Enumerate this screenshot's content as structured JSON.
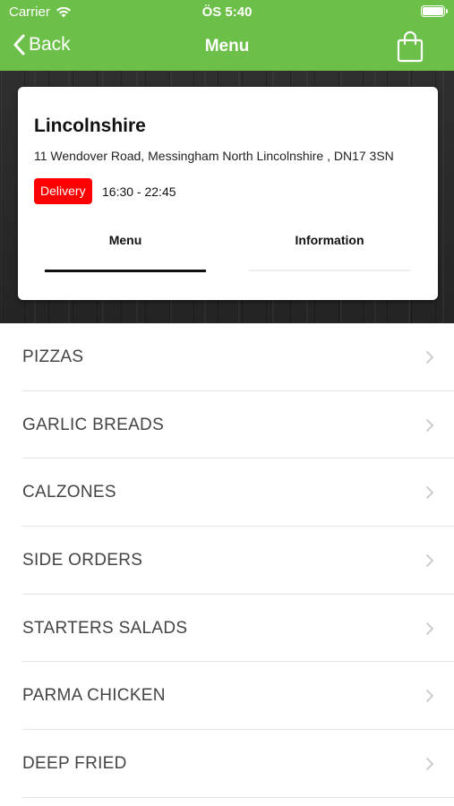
{
  "status_bar": {
    "carrier": "Carrier",
    "time": "ÖS 5:40"
  },
  "nav": {
    "back_label": "Back",
    "title": "Menu"
  },
  "restaurant": {
    "name": "Lincolnshire",
    "address": "11 Wendover Road, Messingham  North Lincolnshire , DN17 3SN",
    "badge": "Delivery",
    "hours": "16:30 - 22:45"
  },
  "tabs": [
    {
      "label": "Menu",
      "active": true
    },
    {
      "label": "Information",
      "active": false
    }
  ],
  "categories": [
    {
      "label": "PIZZAS"
    },
    {
      "label": "GARLIC BREADS"
    },
    {
      "label": "CALZONES"
    },
    {
      "label": "SIDE ORDERS"
    },
    {
      "label": "STARTERS SALADS"
    },
    {
      "label": "PARMA CHICKEN"
    },
    {
      "label": "DEEP FRIED"
    }
  ],
  "colors": {
    "header": "#6cc04a",
    "badge": "#ff0000",
    "text": "#444444"
  }
}
